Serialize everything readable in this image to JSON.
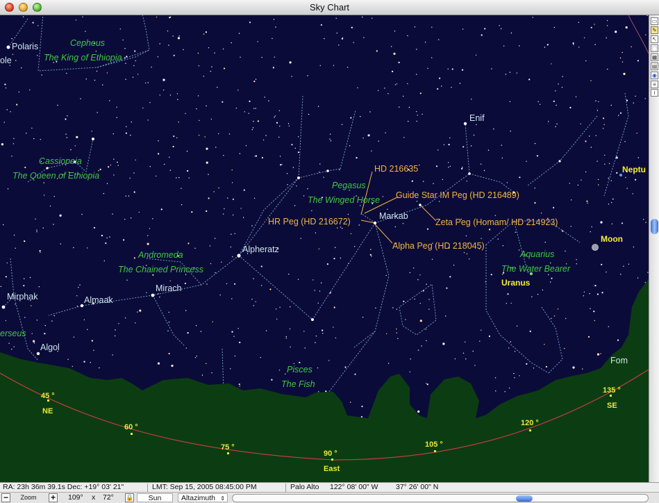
{
  "window": {
    "title": "Sky Chart"
  },
  "labels": {
    "stars": {
      "polaris": "Polaris",
      "enif": "Enif",
      "markab": "Markab",
      "alpheratz": "Alpheratz",
      "mirach": "Mirach",
      "almaak": "Almaak",
      "mirphak": "Mirphak",
      "algol": "Algol",
      "ole": "ole",
      "fom": "Fom"
    },
    "constellations": {
      "cepheus": "Cepheus",
      "cepheus_desc": "The King of Ethiopia",
      "cassiopeia": "Cassiopeia",
      "cassiopeia_desc": "The Queen of Ethiopia",
      "pegasus": "Pegasus",
      "pegasus_desc": "The Winged Horse",
      "andromeda": "Andromeda",
      "andromeda_desc": "The Chained Princess",
      "aquarius": "Aquarius",
      "aquarius_desc": "The Water Bearer",
      "pisces": "Pisces",
      "pisces_desc": "The Fish",
      "perseus": "erseus"
    },
    "objects": {
      "hd216635": "HD 216635",
      "guide_star": "Guide Star IM Peg (HD 216489)",
      "hr_peg": "HR Peg (HD 216672)",
      "zeta_peg": "Zeta Peg  (Homam/ HD 214923)",
      "alpha_peg": "Alpha Peg (HD 218045)"
    },
    "planets": {
      "neptune": "Neptu",
      "moon": "Moon",
      "uranus": "Uranus"
    },
    "horizon": {
      "az45": "45 °",
      "ne": "NE",
      "az60": "60 °",
      "az75": "75 °",
      "az90": "90 °",
      "east": "East",
      "az105": "105 °",
      "az120": "120 °",
      "az135": "135 °",
      "se": "SE"
    }
  },
  "status": {
    "radec": "RA: 23h 36m 39.1s  Dec: +19° 03' 21\"",
    "lmt": "LMT:  Sep 15, 2005    08:45:00 PM",
    "location": "Palo Alto",
    "longitude": "122° 08' 00\" W",
    "latitude": "37° 26' 00\" N"
  },
  "controls": {
    "zoom_label": "Zoom",
    "fov_w": "109°",
    "fov_x": "x",
    "fov_h": "72°",
    "center_object": "Sun",
    "projection": "Altazimuth"
  },
  "colors": {
    "sky": "#0b0b3a",
    "ground": "#0c3d12",
    "horizon_line": "#d63a4a",
    "constellation_lines": "#6f9ec2",
    "star_labels": "#cfe7ec",
    "constellation_names": "#3fc73f",
    "object_labels": "#f3b43c",
    "planet_labels": "#f2ef30"
  },
  "icons": {
    "toolbar": [
      "hand-icon",
      "pencil-icon",
      "cursor-icon",
      "select-icon",
      "grid-icon",
      "globe-icon",
      "layers-icon"
    ],
    "lock": "lock-icon",
    "zoom_out": "minus-icon",
    "zoom_in": "plus-icon"
  }
}
